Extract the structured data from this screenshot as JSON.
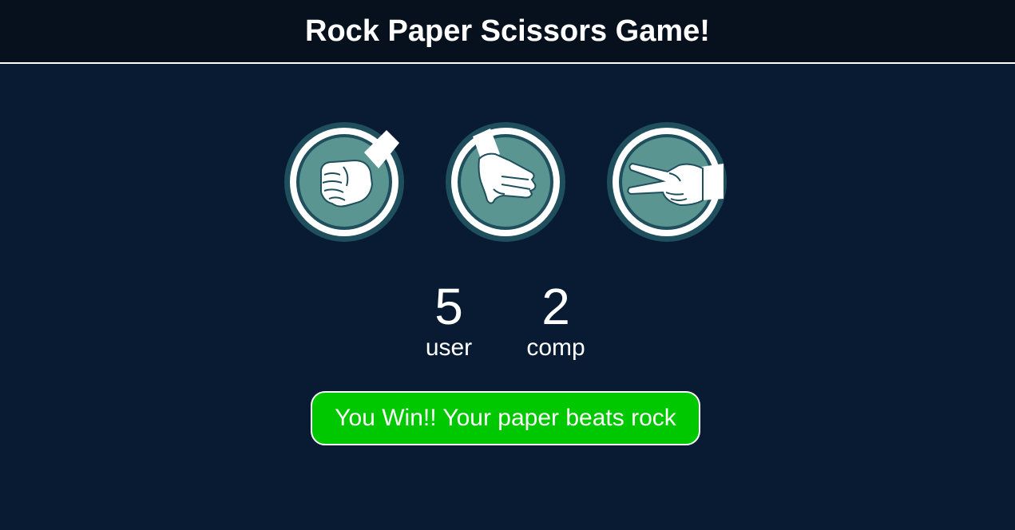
{
  "header": {
    "title": "Rock Paper Scissors Game!"
  },
  "choices": [
    {
      "id": "rock",
      "icon": "rock-fist-icon"
    },
    {
      "id": "paper",
      "icon": "paper-hand-icon"
    },
    {
      "id": "scissors",
      "icon": "scissors-hand-icon"
    }
  ],
  "scoreboard": {
    "user": {
      "score": "5",
      "label": "user"
    },
    "comp": {
      "score": "2",
      "label": "comp"
    }
  },
  "result": {
    "message": "You Win!! Your paper beats rock"
  },
  "colors": {
    "background": "#081b33",
    "header": "#06111d",
    "choice_ring": "#1f4f5c",
    "choice_fill": "#5a9592",
    "win": "#00c800"
  }
}
